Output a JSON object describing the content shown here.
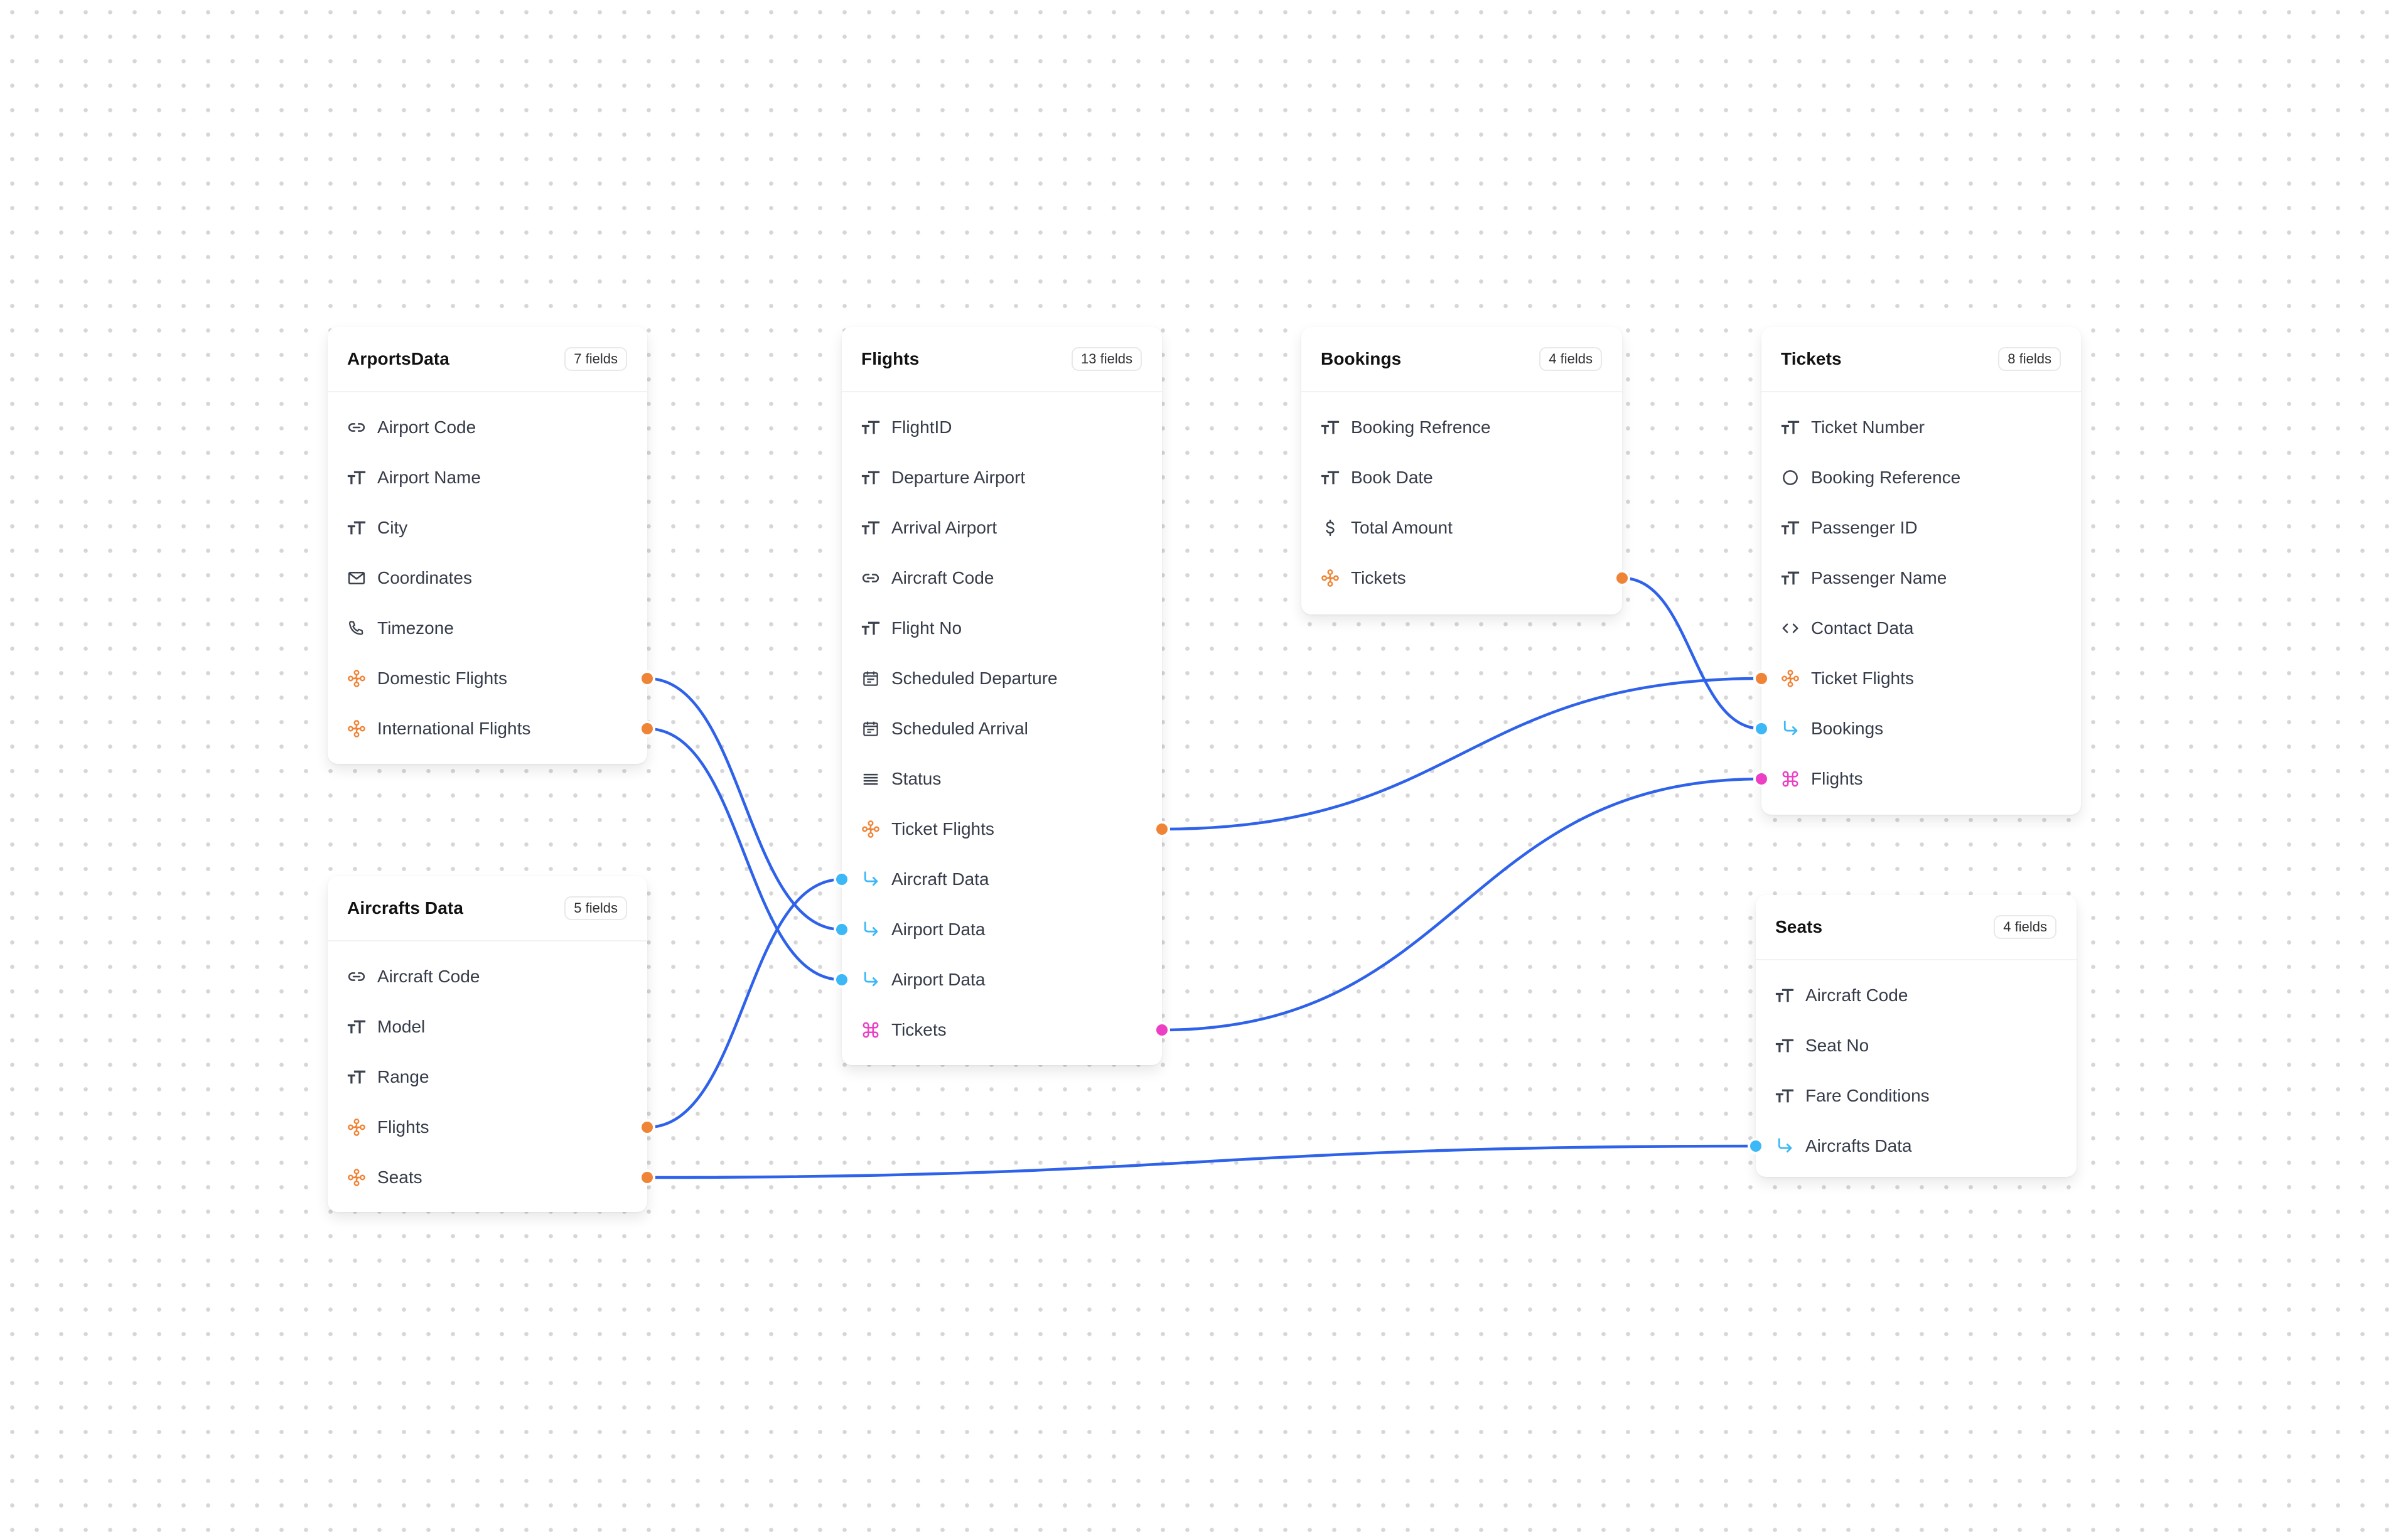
{
  "colors": {
    "edge": "#2f62ea",
    "relation": "#f08436",
    "reference": "#3bb8f5",
    "many": "#ec3fc4",
    "plain": "#3b414d"
  },
  "tables": [
    {
      "id": "arports",
      "title": "ArportsData",
      "badge": "7 fields",
      "fields": [
        {
          "label": "Airport Code",
          "icon": "link-icon",
          "kind": "plain"
        },
        {
          "label": "Airport Name",
          "icon": "text-type-icon",
          "kind": "plain"
        },
        {
          "label": "City",
          "icon": "text-type-icon",
          "kind": "plain"
        },
        {
          "label": "Coordinates",
          "icon": "mail-icon",
          "kind": "plain"
        },
        {
          "label": "Timezone",
          "icon": "phone-icon",
          "kind": "plain"
        },
        {
          "label": "Domestic Flights",
          "icon": "relation-icon",
          "kind": "relation",
          "handle": "right"
        },
        {
          "label": "International Flights",
          "icon": "relation-icon",
          "kind": "relation",
          "handle": "right"
        }
      ]
    },
    {
      "id": "aircrafts",
      "title": "Aircrafts Data",
      "badge": "5 fields",
      "fields": [
        {
          "label": "Aircraft Code",
          "icon": "link-icon",
          "kind": "plain"
        },
        {
          "label": "Model",
          "icon": "text-type-icon",
          "kind": "plain"
        },
        {
          "label": "Range",
          "icon": "text-type-icon",
          "kind": "plain"
        },
        {
          "label": "Flights",
          "icon": "relation-icon",
          "kind": "relation",
          "handle": "right"
        },
        {
          "label": "Seats",
          "icon": "relation-icon",
          "kind": "relation",
          "handle": "right"
        }
      ]
    },
    {
      "id": "flights",
      "title": "Flights",
      "badge": "13 fields",
      "fields": [
        {
          "label": "FlightID",
          "icon": "text-type-icon",
          "kind": "plain"
        },
        {
          "label": "Departure Airport",
          "icon": "text-type-icon",
          "kind": "plain"
        },
        {
          "label": "Arrival Airport",
          "icon": "text-type-icon",
          "kind": "plain"
        },
        {
          "label": "Aircraft Code",
          "icon": "link-icon",
          "kind": "plain"
        },
        {
          "label": "Flight No",
          "icon": "text-type-icon",
          "kind": "plain"
        },
        {
          "label": "Scheduled Departure",
          "icon": "calendar-icon",
          "kind": "plain"
        },
        {
          "label": "Scheduled Arrival",
          "icon": "calendar-icon",
          "kind": "plain"
        },
        {
          "label": "Status",
          "icon": "list-icon",
          "kind": "plain"
        },
        {
          "label": "Ticket Flights",
          "icon": "relation-icon",
          "kind": "relation",
          "handle": "right"
        },
        {
          "label": "Aircraft Data",
          "icon": "reference-arrow-icon",
          "kind": "reference",
          "handle": "left"
        },
        {
          "label": "Airport Data",
          "icon": "reference-arrow-icon",
          "kind": "reference",
          "handle": "left"
        },
        {
          "label": "Airport Data",
          "icon": "reference-arrow-icon",
          "kind": "reference",
          "handle": "left"
        },
        {
          "label": "Tickets",
          "icon": "command-icon",
          "kind": "many",
          "handle": "right"
        }
      ]
    },
    {
      "id": "bookings",
      "title": "Bookings",
      "badge": "4 fields",
      "fields": [
        {
          "label": "Booking Refrence",
          "icon": "text-type-icon",
          "kind": "plain"
        },
        {
          "label": "Book Date",
          "icon": "text-type-icon",
          "kind": "plain"
        },
        {
          "label": "Total Amount",
          "icon": "dollar-icon",
          "kind": "plain"
        },
        {
          "label": "Tickets",
          "icon": "relation-icon",
          "kind": "relation",
          "handle": "right"
        }
      ]
    },
    {
      "id": "tickets",
      "title": "Tickets",
      "badge": "8 fields",
      "fields": [
        {
          "label": "Ticket Number",
          "icon": "text-type-icon",
          "kind": "plain"
        },
        {
          "label": "Booking Reference",
          "icon": "circle-icon",
          "kind": "plain"
        },
        {
          "label": "Passenger ID",
          "icon": "text-type-icon",
          "kind": "plain"
        },
        {
          "label": "Passenger Name",
          "icon": "text-type-icon",
          "kind": "plain"
        },
        {
          "label": "Contact Data",
          "icon": "code-icon",
          "kind": "plain"
        },
        {
          "label": "Ticket Flights",
          "icon": "relation-icon",
          "kind": "relation",
          "handle": "left"
        },
        {
          "label": "Bookings",
          "icon": "reference-arrow-icon",
          "kind": "reference",
          "handle": "left"
        },
        {
          "label": "Flights",
          "icon": "command-icon",
          "kind": "many",
          "handle": "left"
        }
      ]
    },
    {
      "id": "seats",
      "title": "Seats",
      "badge": "4 fields",
      "fields": [
        {
          "label": "Aircraft Code",
          "icon": "text-type-icon",
          "kind": "plain"
        },
        {
          "label": "Seat No",
          "icon": "text-type-icon",
          "kind": "plain"
        },
        {
          "label": "Fare Conditions",
          "icon": "text-type-icon",
          "kind": "plain"
        },
        {
          "label": "Aircrafts Data",
          "icon": "reference-arrow-icon",
          "kind": "reference",
          "handle": "left"
        }
      ]
    }
  ],
  "edges": [
    {
      "from": [
        "arports",
        5
      ],
      "to": [
        "flights",
        10
      ]
    },
    {
      "from": [
        "arports",
        6
      ],
      "to": [
        "flights",
        11
      ]
    },
    {
      "from": [
        "aircrafts",
        3
      ],
      "to": [
        "flights",
        9
      ]
    },
    {
      "from": [
        "aircrafts",
        4
      ],
      "to": [
        "seats",
        3
      ]
    },
    {
      "from": [
        "flights",
        8
      ],
      "to": [
        "tickets",
        5
      ]
    },
    {
      "from": [
        "flights",
        12
      ],
      "to": [
        "tickets",
        7
      ]
    },
    {
      "from": [
        "bookings",
        3
      ],
      "to": [
        "tickets",
        6
      ]
    }
  ]
}
